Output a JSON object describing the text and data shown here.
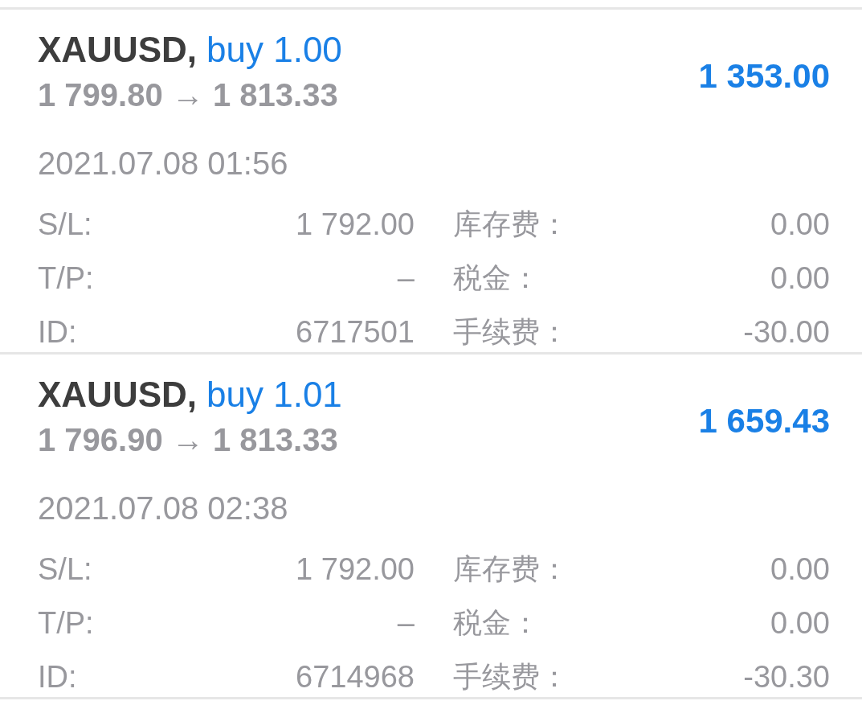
{
  "positions": [
    {
      "symbol": "XAUUSD,",
      "side": "buy 1.00",
      "prices": "1 799.80 → 1 813.33",
      "profit": "1 353.00",
      "time": "2021.07.08 01:56",
      "details": [
        {
          "label": "S/L:",
          "value": "1 792.00"
        },
        {
          "label": "T/P:",
          "value": "–"
        },
        {
          "label": "ID:",
          "value": "6717501"
        }
      ],
      "charges": [
        {
          "label": "库存费：",
          "value": "0.00"
        },
        {
          "label": "税金：",
          "value": "0.00"
        },
        {
          "label": "手续费：",
          "value": "-30.00"
        }
      ]
    },
    {
      "symbol": "XAUUSD,",
      "side": "buy 1.01",
      "prices": "1 796.90 → 1 813.33",
      "profit": "1 659.43",
      "time": "2021.07.08 02:38",
      "details": [
        {
          "label": "S/L:",
          "value": "1 792.00"
        },
        {
          "label": "T/P:",
          "value": "–"
        },
        {
          "label": "ID:",
          "value": "6714968"
        }
      ],
      "charges": [
        {
          "label": "库存费：",
          "value": "0.00"
        },
        {
          "label": "税金：",
          "value": "0.00"
        },
        {
          "label": "手续费：",
          "value": "-30.30"
        }
      ]
    }
  ]
}
